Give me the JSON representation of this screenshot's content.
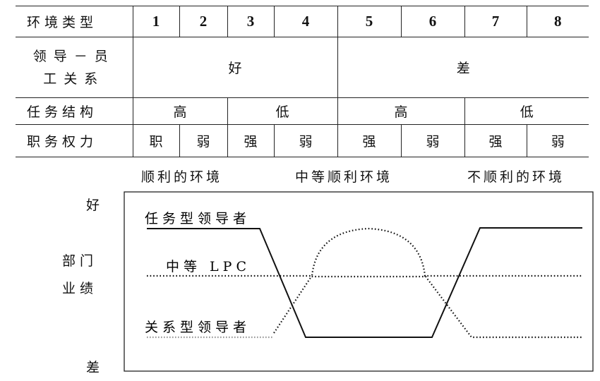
{
  "table": {
    "row_env": {
      "label": "环境类型",
      "cells": [
        "1",
        "2",
        "3",
        "4",
        "5",
        "6",
        "7",
        "8"
      ]
    },
    "row_relation": {
      "label_line1": "领导－员",
      "label_line2": "工关系",
      "good": "好",
      "bad": "差"
    },
    "row_structure": {
      "label": "任务结构",
      "values": [
        "高",
        "低",
        "高",
        "低"
      ]
    },
    "row_power": {
      "label": "职务权力",
      "values": [
        "职",
        "弱",
        "强",
        "弱",
        "强",
        "弱",
        "强",
        "弱"
      ]
    }
  },
  "favorability": {
    "favorable": "顺利的环境",
    "moderate": "中等顺利环境",
    "unfavorable": "不顺利的环境"
  },
  "chart": {
    "y_top": "好",
    "y_mid_line1": "部门",
    "y_mid_line2": "业绩",
    "y_bottom": "差",
    "task_leader": "任务型领导者",
    "mid_lpc": "中等 LPC",
    "relation_leader": "关系型领导者"
  }
}
